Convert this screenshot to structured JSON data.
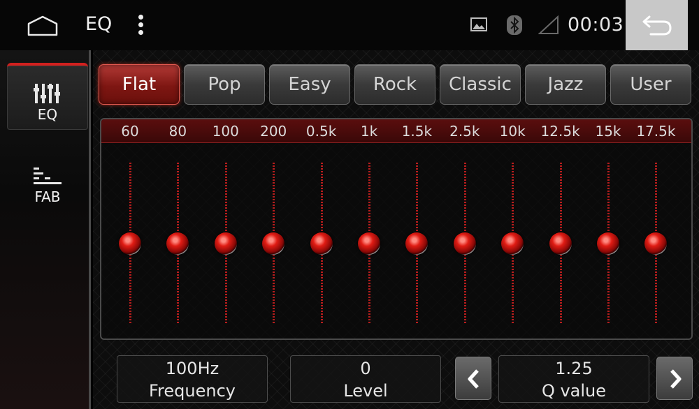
{
  "statusbar": {
    "title": "EQ",
    "clock": "00:03",
    "icons": [
      "home-icon",
      "overflow-menu-icon",
      "image-icon",
      "bluetooth-icon",
      "signal-icon",
      "back-icon"
    ]
  },
  "sidebar": {
    "items": [
      {
        "label": "EQ",
        "icon": "equalizer-icon",
        "active": true
      },
      {
        "label": "FAB",
        "icon": "fader-balance-icon",
        "active": false
      }
    ]
  },
  "presets": {
    "items": [
      "Flat",
      "Pop",
      "Easy",
      "Rock",
      "Classic",
      "Jazz",
      "User"
    ],
    "active": "Flat"
  },
  "eq": {
    "bands": [
      "60",
      "80",
      "100",
      "200",
      "0.5k",
      "1k",
      "1.5k",
      "2.5k",
      "10k",
      "12.5k",
      "15k",
      "17.5k"
    ],
    "levels": [
      0,
      0,
      0,
      0,
      0,
      0,
      0,
      0,
      0,
      0,
      0,
      0
    ],
    "range": [
      -12,
      12
    ]
  },
  "controls": {
    "frequency": {
      "value": "100Hz",
      "label": "Frequency"
    },
    "level": {
      "value": "0",
      "label": "Level"
    },
    "q": {
      "value": "1.25",
      "label": "Q value"
    }
  },
  "colors": {
    "accent": "#d3201e",
    "status_bar": "#060606",
    "back_button": "#c8c8c8"
  }
}
